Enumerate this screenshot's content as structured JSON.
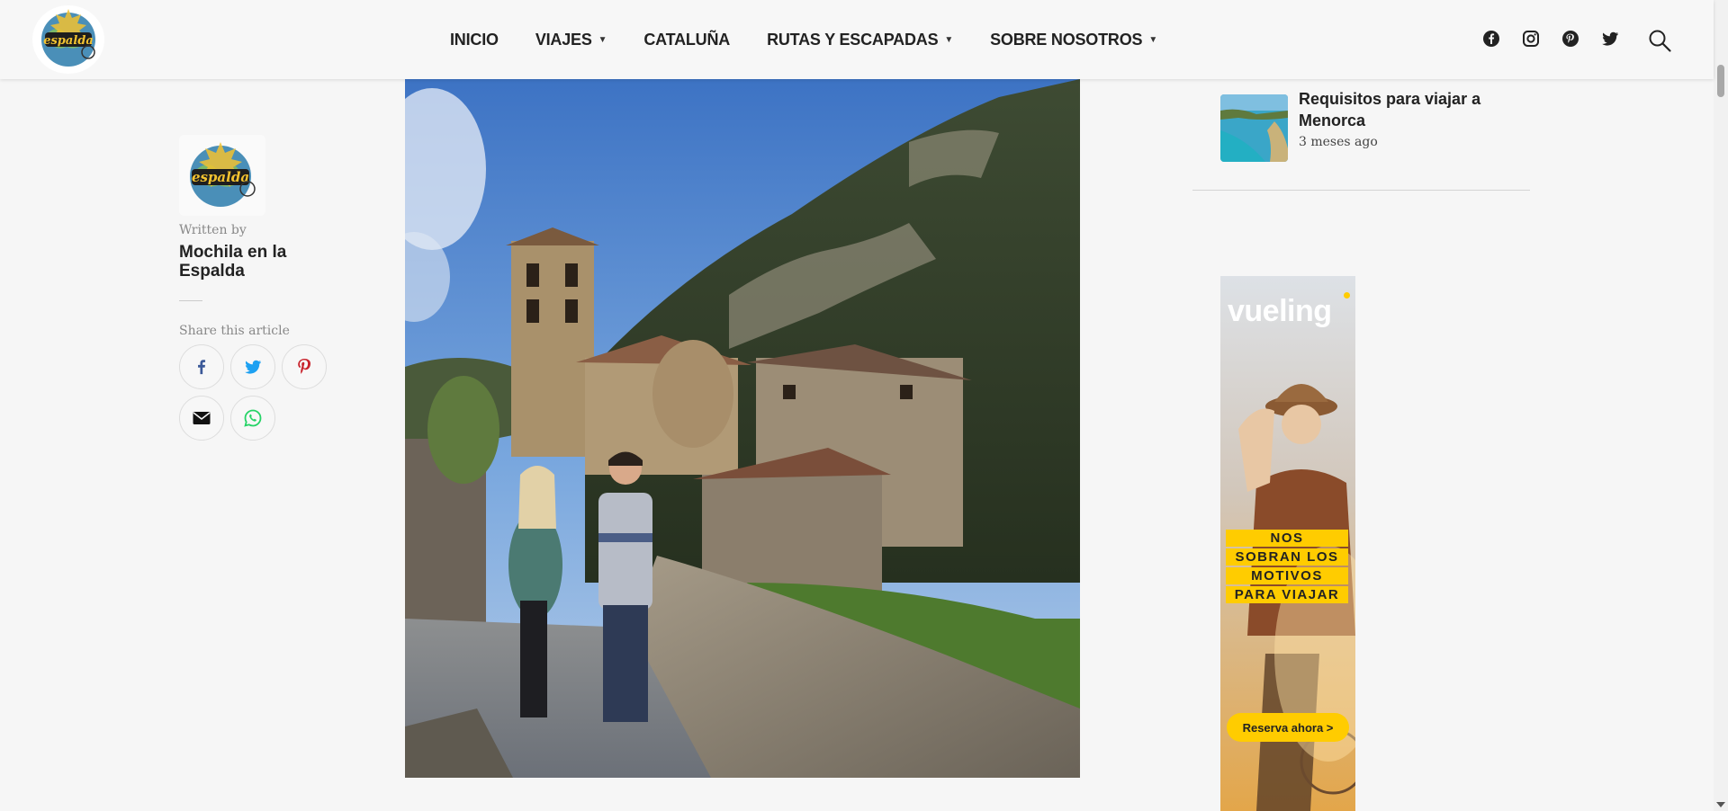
{
  "header": {
    "nav": [
      {
        "label": "INICIO",
        "dropdown": false
      },
      {
        "label": "VIAJES",
        "dropdown": true
      },
      {
        "label": "CATALUÑA",
        "dropdown": false
      },
      {
        "label": "RUTAS Y ESCAPADAS",
        "dropdown": true
      },
      {
        "label": "SOBRE NOSOTROS",
        "dropdown": true
      }
    ],
    "social_icons": [
      "facebook-icon",
      "instagram-icon",
      "pinterest-icon",
      "twitter-icon"
    ],
    "search_icon": "search-icon"
  },
  "author": {
    "written_by": "Written by",
    "name": "Mochila en la Espalda",
    "share_label": "Share this article",
    "share_buttons": [
      "facebook-icon",
      "twitter-icon",
      "pinterest-icon",
      "email-icon",
      "whatsapp-icon"
    ]
  },
  "sidebar": {
    "recent_post": {
      "title": "Requisitos para viajar a Menorca",
      "meta": "3 meses ago"
    },
    "ad": {
      "brand": "vueling",
      "slogan": [
        "NOS",
        "SOBRAN LOS",
        "MOTIVOS",
        "PARA VIAJAR"
      ],
      "cta": "Reserva ahora  >"
    }
  },
  "colors": {
    "accent_yellow": "#ffcc00",
    "facebook": "#3b5998",
    "twitter": "#1da1f2",
    "pinterest": "#c8232c",
    "whatsapp": "#25d366"
  }
}
